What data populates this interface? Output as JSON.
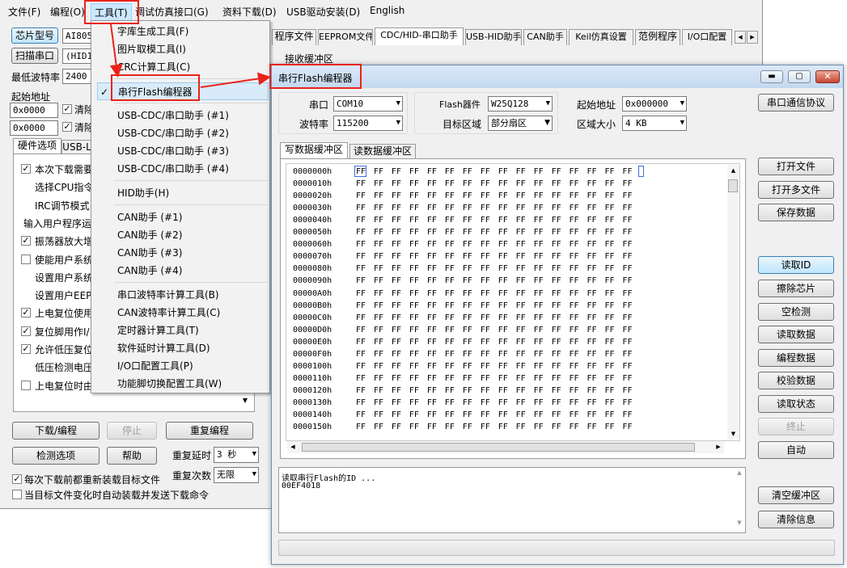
{
  "main": {
    "menubar": [
      "文件(F)",
      "编程(O)",
      "工具(T)",
      "调试仿真接口(G)",
      "资料下载(D)",
      "USB驱动安装(D)",
      "English"
    ],
    "chip_type_label": "芯片型号",
    "chip_value": "AI8051",
    "scan_port_label": "扫描串口",
    "port_value": "(HID1)",
    "min_baud_label": "最低波特率",
    "min_baud_value": "2400",
    "start_addr_label": "起始地址",
    "addr1": "0x0000",
    "addr2": "0x0000",
    "clear1": "清除",
    "clear2": "清除",
    "left_tabs": [
      "硬件选项",
      "USB-L"
    ],
    "options": [
      {
        "text": "本次下载需要",
        "checked": true
      },
      {
        "text": "选择CPU指令",
        "checked": null
      },
      {
        "text": "IRC调节模式",
        "checked": null
      },
      {
        "text": "输入用户程序运",
        "checked": null
      },
      {
        "text": "振荡器放大增",
        "checked": true
      },
      {
        "text": "使能用户系统",
        "checked": false
      },
      {
        "text": "设置用户系统",
        "checked": null
      },
      {
        "text": "设置用户EEPR",
        "checked": null
      },
      {
        "text": "上电复位使用",
        "checked": true
      },
      {
        "text": "复位脚用作I/",
        "checked": true
      },
      {
        "text": "允许低压复位",
        "checked": true
      },
      {
        "text": "低压检测电压",
        "checked": null
      },
      {
        "text": "上电复位时由",
        "checked": false
      }
    ],
    "download_btn": "下载/编程",
    "stop_btn": "停止",
    "reprogram_btn": "重复编程",
    "check_btn": "检测选项",
    "help_btn": "帮助",
    "repeat_delay_label": "重复延时",
    "repeat_delay_value": "3 秒",
    "repeat_count_label": "重复次数",
    "repeat_count_value": "无限",
    "reload_check": "每次下载前都重新装载目标文件",
    "auto_check": "当目标文件变化时自动装载并发送下载命令",
    "right_tabs": [
      "程序文件",
      "EEPROM文件",
      "CDC/HID-串口助手",
      "USB-HID助手",
      "CAN助手",
      "Keil仿真设置",
      "范例程序",
      "I/O口配置"
    ],
    "recv_buffer_label": "接收缓冲区"
  },
  "tools_menu": {
    "items": [
      {
        "label": "字库生成工具(F)",
        "checked": false
      },
      {
        "label": "图片取模工具(I)",
        "checked": false
      },
      {
        "label": "CRC计算工具(C)",
        "checked": false
      },
      {
        "sep": true
      },
      {
        "label": "串行Flash编程器",
        "checked": true
      },
      {
        "sep": true
      },
      {
        "label": "USB-CDC/串口助手 (#1)",
        "checked": false
      },
      {
        "label": "USB-CDC/串口助手 (#2)",
        "checked": false
      },
      {
        "label": "USB-CDC/串口助手 (#3)",
        "checked": false
      },
      {
        "label": "USB-CDC/串口助手 (#4)",
        "checked": false
      },
      {
        "sep": true
      },
      {
        "label": "HID助手(H)",
        "checked": false
      },
      {
        "sep": true
      },
      {
        "label": "CAN助手 (#1)",
        "checked": false
      },
      {
        "label": "CAN助手 (#2)",
        "checked": false
      },
      {
        "label": "CAN助手 (#3)",
        "checked": false
      },
      {
        "label": "CAN助手 (#4)",
        "checked": false
      },
      {
        "sep": true
      },
      {
        "label": "串口波特率计算工具(B)",
        "checked": false
      },
      {
        "label": "CAN波特率计算工具(C)",
        "checked": false
      },
      {
        "label": "定时器计算工具(T)",
        "checked": false
      },
      {
        "label": "软件延时计算工具(D)",
        "checked": false
      },
      {
        "label": "I/O口配置工具(P)",
        "checked": false
      },
      {
        "label": "功能脚切换配置工具(W)",
        "checked": false
      }
    ]
  },
  "flash_window": {
    "title": "串行Flash编程器",
    "port_label": "串口",
    "port_value": "COM10",
    "baud_label": "波特率",
    "baud_value": "115200",
    "device_label": "Flash器件",
    "device_value": "W25Q128",
    "target_label": "目标区域",
    "target_value": "部分扇区",
    "start_label": "起始地址",
    "start_value": "0x000000",
    "size_label": "区域大小",
    "size_value": "4 KB",
    "protocol_btn": "串口通信协议",
    "tabs": [
      "写数据缓冲区",
      "读数据缓冲区"
    ],
    "hex_rows": [
      {
        "addr": "0000000h",
        "data": "FF FF FF FF FF FF FF FF FF FF FF FF FF FF FF FF"
      },
      {
        "addr": "0000010h",
        "data": "FF FF FF FF FF FF FF FF FF FF FF FF FF FF FF FF"
      },
      {
        "addr": "0000020h",
        "data": "FF FF FF FF FF FF FF FF FF FF FF FF FF FF FF FF"
      },
      {
        "addr": "0000030h",
        "data": "FF FF FF FF FF FF FF FF FF FF FF FF FF FF FF FF"
      },
      {
        "addr": "0000040h",
        "data": "FF FF FF FF FF FF FF FF FF FF FF FF FF FF FF FF"
      },
      {
        "addr": "0000050h",
        "data": "FF FF FF FF FF FF FF FF FF FF FF FF FF FF FF FF"
      },
      {
        "addr": "0000060h",
        "data": "FF FF FF FF FF FF FF FF FF FF FF FF FF FF FF FF"
      },
      {
        "addr": "0000070h",
        "data": "FF FF FF FF FF FF FF FF FF FF FF FF FF FF FF FF"
      },
      {
        "addr": "0000080h",
        "data": "FF FF FF FF FF FF FF FF FF FF FF FF FF FF FF FF"
      },
      {
        "addr": "0000090h",
        "data": "FF FF FF FF FF FF FF FF FF FF FF FF FF FF FF FF"
      },
      {
        "addr": "00000A0h",
        "data": "FF FF FF FF FF FF FF FF FF FF FF FF FF FF FF FF"
      },
      {
        "addr": "00000B0h",
        "data": "FF FF FF FF FF FF FF FF FF FF FF FF FF FF FF FF"
      },
      {
        "addr": "00000C0h",
        "data": "FF FF FF FF FF FF FF FF FF FF FF FF FF FF FF FF"
      },
      {
        "addr": "00000D0h",
        "data": "FF FF FF FF FF FF FF FF FF FF FF FF FF FF FF FF"
      },
      {
        "addr": "00000E0h",
        "data": "FF FF FF FF FF FF FF FF FF FF FF FF FF FF FF FF"
      },
      {
        "addr": "00000F0h",
        "data": "FF FF FF FF FF FF FF FF FF FF FF FF FF FF FF FF"
      },
      {
        "addr": "0000100h",
        "data": "FF FF FF FF FF FF FF FF FF FF FF FF FF FF FF FF"
      },
      {
        "addr": "0000110h",
        "data": "FF FF FF FF FF FF FF FF FF FF FF FF FF FF FF FF"
      },
      {
        "addr": "0000120h",
        "data": "FF FF FF FF FF FF FF FF FF FF FF FF FF FF FF FF"
      },
      {
        "addr": "0000130h",
        "data": "FF FF FF FF FF FF FF FF FF FF FF FF FF FF FF FF"
      },
      {
        "addr": "0000140h",
        "data": "FF FF FF FF FF FF FF FF FF FF FF FF FF FF FF FF"
      },
      {
        "addr": "0000150h",
        "data": "FF FF FF FF FF FF FF FF FF FF FF FF FF FF FF FF"
      }
    ],
    "side_buttons": [
      {
        "label": "打开文件",
        "enabled": true
      },
      {
        "label": "打开多文件",
        "enabled": true
      },
      {
        "label": "保存数据",
        "enabled": true
      },
      {
        "label": "读取ID",
        "enabled": true
      },
      {
        "label": "擦除芯片",
        "enabled": true
      },
      {
        "label": "空检测",
        "enabled": true
      },
      {
        "label": "读取数据",
        "enabled": true
      },
      {
        "label": "编程数据",
        "enabled": true
      },
      {
        "label": "校验数据",
        "enabled": true
      },
      {
        "label": "读取状态",
        "enabled": true
      },
      {
        "label": "终止",
        "enabled": false
      },
      {
        "label": "自动",
        "enabled": true
      }
    ],
    "log_lines": [
      "读取串行Flash的ID ...",
      "00EF4018"
    ],
    "clear_buffer_btn": "清空缓冲区",
    "clear_info_btn": "清除信息"
  },
  "colors": {
    "highlight_red": "#e8231b",
    "focus_blue": "#3c7fb1",
    "title_bg": "#cfe0f3"
  }
}
